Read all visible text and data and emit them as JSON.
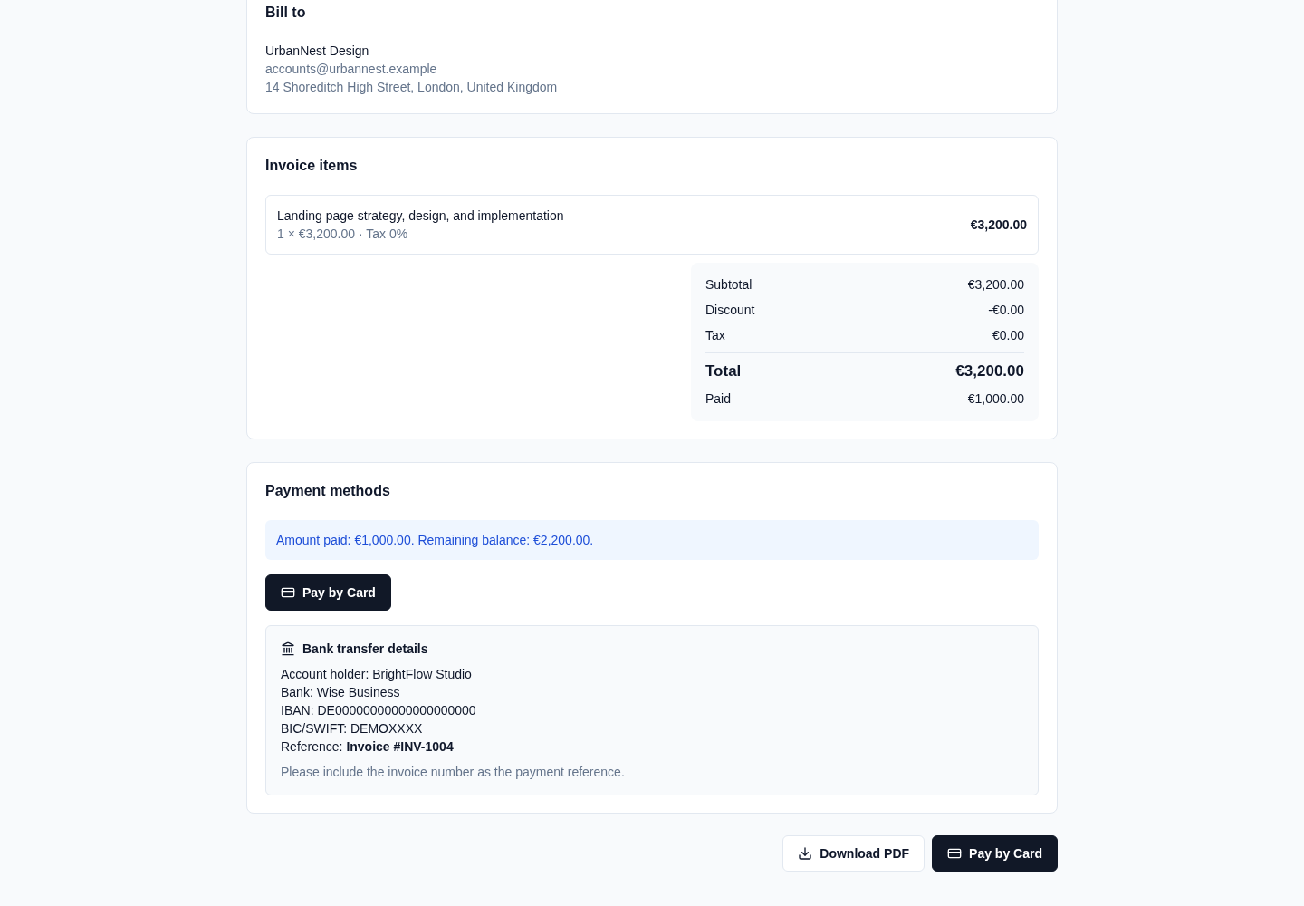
{
  "bill_to": {
    "title": "Bill to",
    "name": "UrbanNest Design",
    "email": "accounts@urbannest.example",
    "address": "14 Shoreditch High Street, London, United Kingdom"
  },
  "invoice_items": {
    "title": "Invoice items",
    "items": [
      {
        "description": "Landing page strategy, design, and implementation",
        "detail": "1 × €3,200.00 · Tax 0%",
        "amount": "€3,200.00"
      }
    ],
    "totals": [
      {
        "kind": "line",
        "label": "Subtotal",
        "value": "€3,200.00"
      },
      {
        "kind": "line",
        "label": "Discount",
        "value": "-€0.00"
      },
      {
        "kind": "line",
        "label": "Tax",
        "value": "€0.00"
      },
      {
        "kind": "total",
        "label": "Total",
        "value": "€3,200.00"
      },
      {
        "kind": "line",
        "label": "Paid",
        "value": "€1,000.00"
      }
    ]
  },
  "payment_methods": {
    "title": "Payment methods",
    "notice": "Amount paid: €1,000.00. Remaining balance: €2,200.00.",
    "card_button": "Pay by Card",
    "bank_transfer": {
      "title": "Bank transfer details",
      "lines": [
        "Account holder: BrightFlow Studio",
        "Bank: Wise Business",
        "IBAN: DE00000000000000000000",
        "BIC/SWIFT: DEMOXXXX",
        "Reference: **Invoice #INV-1004**"
      ],
      "note": "Please include the invoice number as the payment reference."
    }
  },
  "actions": [
    {
      "kind": "secondary",
      "label": "Download PDF"
    },
    {
      "kind": "primary",
      "label": "Pay by Card"
    }
  ]
}
